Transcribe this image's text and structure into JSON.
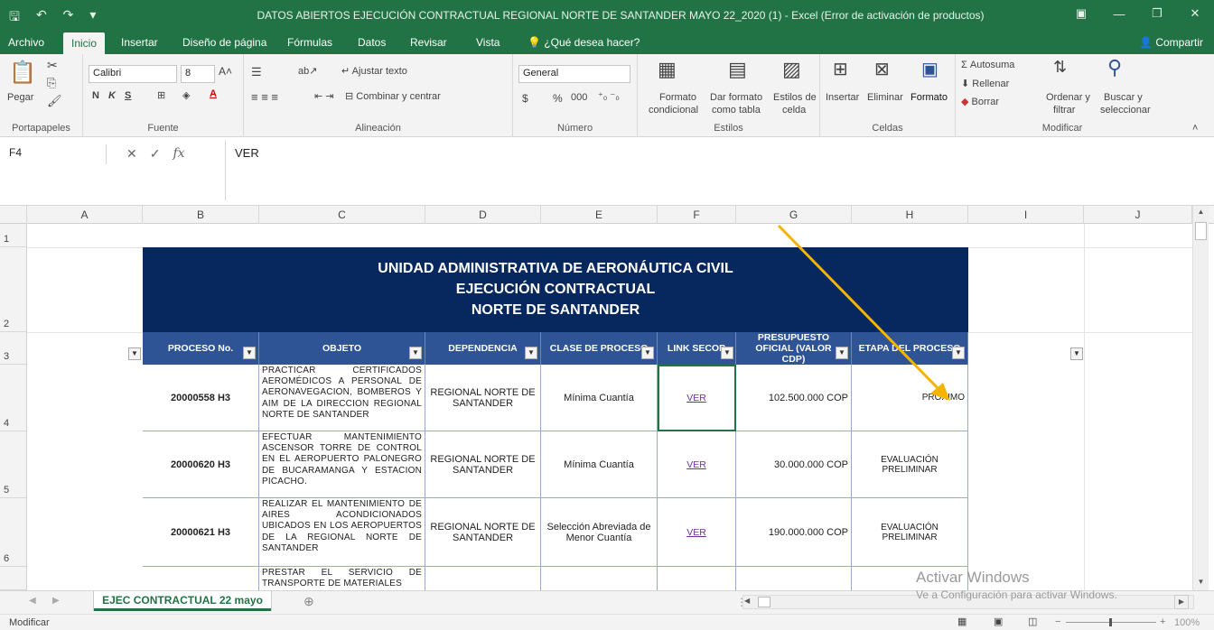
{
  "window": {
    "title": "DATOS ABIERTOS  EJECUCIÓN CONTRACTUAL REGIONAL NORTE DE SANTANDER MAYO 22_2020 (1) - Excel (Error de activación de productos)"
  },
  "ribbon_tabs": [
    "Archivo",
    "Inicio",
    "Insertar",
    "Diseño de página",
    "Fórmulas",
    "Datos",
    "Revisar",
    "Vista"
  ],
  "tell_me": "¿Qué desea hacer?",
  "share": "Compartir",
  "ribbon": {
    "clipboard": {
      "paste": "Pegar",
      "label": "Portapapeles"
    },
    "font": {
      "name": "Calibri",
      "size": "8",
      "bold": "N",
      "italic": "K",
      "underline": "S",
      "label": "Fuente"
    },
    "alignment": {
      "wrap": "Ajustar texto",
      "merge": "Combinar y centrar",
      "label": "Alineación"
    },
    "number": {
      "format": "General",
      "currency": "$",
      "percent": "%",
      "thousands": "000",
      "label": "Número"
    },
    "styles": {
      "conditional_1": "Formato",
      "conditional_2": "condicional",
      "table_1": "Dar formato",
      "table_2": "como tabla",
      "cell_1": "Estilos de",
      "cell_2": "celda",
      "label": "Estilos"
    },
    "cells": {
      "insert": "Insertar",
      "delete": "Eliminar",
      "format": "Formato",
      "label": "Celdas"
    },
    "editing": {
      "autosum": "Autosuma",
      "fill": "Rellenar",
      "clear": "Borrar",
      "sort_1": "Ordenar y",
      "sort_2": "filtrar",
      "find_1": "Buscar y",
      "find_2": "seleccionar",
      "label": "Modificar"
    }
  },
  "formula_bar": {
    "cell_ref": "F4",
    "fx": "fx",
    "value": "VER"
  },
  "columns": [
    "A",
    "B",
    "C",
    "D",
    "E",
    "F",
    "G",
    "H",
    "I",
    "J"
  ],
  "row_numbers": [
    "1",
    "2",
    "3",
    "4",
    "5",
    "6"
  ],
  "banner": [
    "UNIDAD ADMINISTRATIVA DE AERONÁUTICA CIVIL",
    "EJECUCIÓN CONTRACTUAL",
    "NORTE DE SANTANDER"
  ],
  "table_headers": [
    "PROCESO No.",
    "OBJETO",
    "DEPENDENCIA",
    "CLASE DE PROCESO",
    "LINK SECOP",
    "PRESUPUESTO OFICIAL (VALOR CDP)",
    "ETAPA DEL PROCESO"
  ],
  "rows": [
    {
      "proceso": "20000558 H3",
      "objeto": "PRACTICAR CERTIFICADOS AEROMÉDICOS A PERSONAL DE AERONAVEGACION, BOMBEROS Y AIM DE LA DIRECCION REGIONAL NORTE DE SANTANDER",
      "dependencia": "REGIONAL NORTE DE SANTANDER",
      "clase": "Mínima Cuantía",
      "link": "VER",
      "presupuesto": "102.500.000 COP",
      "etapa": "PRÓXIMO"
    },
    {
      "proceso": "20000620 H3",
      "objeto": "EFECTUAR MANTENIMIENTO ASCENSOR TORRE DE CONTROL EN EL AEROPUERTO PALONEGRO DE BUCARAMANGA Y ESTACION PICACHO.",
      "dependencia": "REGIONAL NORTE DE SANTANDER",
      "clase": "Mínima Cuantía",
      "link": "VER",
      "presupuesto": "30.000.000 COP",
      "etapa": "EVALUACIÓN PRELIMINAR"
    },
    {
      "proceso": "20000621 H3",
      "objeto": "REALIZAR EL MANTENIMIENTO DE AIRES ACONDICIONADOS UBICADOS EN LOS AEROPUERTOS DE LA REGIONAL NORTE DE SANTANDER",
      "dependencia": "REGIONAL NORTE DE SANTANDER",
      "clase": "Selección Abreviada de Menor Cuantía",
      "link": "VER",
      "presupuesto": "190.000.000 COP",
      "etapa": "EVALUACIÓN PRELIMINAR"
    },
    {
      "proceso": "",
      "objeto": "PRESTAR EL SERVICIO DE TRANSPORTE DE MATERIALES",
      "dependencia": "",
      "clase": "",
      "link": "",
      "presupuesto": "",
      "etapa": ""
    }
  ],
  "sheet_tab": "EJEC CONTRACTUAL 22 mayo",
  "status": "Modificar",
  "zoom": "100%",
  "watermark": {
    "line1": "Activar Windows",
    "line2": "Ve a Configuración para activar Windows."
  },
  "annotation_color": "#f5b400"
}
